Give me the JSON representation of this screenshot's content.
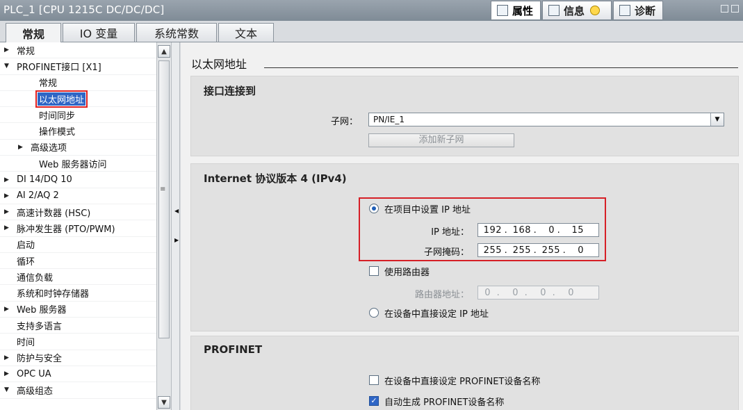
{
  "titlebar": {
    "title": "PLC_1 [CPU 1215C DC/DC/DC]",
    "tabs": [
      {
        "label": "属性",
        "icon": "properties-icon"
      },
      {
        "label": "信息",
        "icon": "info-icon"
      },
      {
        "label": "诊断",
        "icon": "diagnostics-icon"
      }
    ]
  },
  "main_tabs": [
    "常规",
    "IO 变量",
    "系统常数",
    "文本"
  ],
  "tree": [
    {
      "label": "常规",
      "toggle": "▶",
      "indent": 0
    },
    {
      "label": "PROFINET接口 [X1]",
      "toggle": "▼",
      "indent": 0
    },
    {
      "label": "常规",
      "toggle": "",
      "indent": 2
    },
    {
      "label": "以太网地址",
      "toggle": "",
      "indent": 2,
      "selected": true
    },
    {
      "label": "时间同步",
      "toggle": "",
      "indent": 2
    },
    {
      "label": "操作模式",
      "toggle": "",
      "indent": 2
    },
    {
      "label": "高级选项",
      "toggle": "▶",
      "indent": 1
    },
    {
      "label": "Web 服务器访问",
      "toggle": "",
      "indent": 2
    },
    {
      "label": "DI 14/DQ 10",
      "toggle": "▶",
      "indent": 0
    },
    {
      "label": "AI 2/AQ 2",
      "toggle": "▶",
      "indent": 0
    },
    {
      "label": "高速计数器 (HSC)",
      "toggle": "▶",
      "indent": 0
    },
    {
      "label": "脉冲发生器 (PTO/PWM)",
      "toggle": "▶",
      "indent": 0
    },
    {
      "label": "启动",
      "toggle": "",
      "indent": 0
    },
    {
      "label": "循环",
      "toggle": "",
      "indent": 0
    },
    {
      "label": "通信负载",
      "toggle": "",
      "indent": 0
    },
    {
      "label": "系统和时钟存储器",
      "toggle": "",
      "indent": 0
    },
    {
      "label": "Web 服务器",
      "toggle": "▶",
      "indent": 0
    },
    {
      "label": "支持多语言",
      "toggle": "",
      "indent": 0
    },
    {
      "label": "时间",
      "toggle": "",
      "indent": 0
    },
    {
      "label": "防护与安全",
      "toggle": "▶",
      "indent": 0
    },
    {
      "label": "OPC UA",
      "toggle": "▶",
      "indent": 0
    },
    {
      "label": "高级组态",
      "toggle": "▼",
      "indent": 0
    }
  ],
  "content": {
    "page_title": "以太网地址",
    "interface": {
      "title": "接口连接到",
      "subnet_label": "子网：",
      "subnet_value": "PN/IE_1",
      "add_subnet_button": "添加新子网"
    },
    "ipv4": {
      "title": "Internet 协议版本 4 (IPv4)",
      "set_in_project_label": "在项目中设置 IP 地址",
      "ip_label": "IP 地址：",
      "ip": [
        "192",
        "168",
        "0",
        "15"
      ],
      "mask_label": "子网掩码：",
      "mask": [
        "255",
        "255",
        "255",
        "0"
      ],
      "use_router_label": "使用路由器",
      "router_label": "路由器地址：",
      "router": [
        "0",
        "0",
        "0",
        "0"
      ],
      "set_on_device_label": "在设备中直接设定 IP 地址"
    },
    "profinet": {
      "title": "PROFINET",
      "set_name_on_device_label": "在设备中直接设定 PROFINET设备名称",
      "auto_name_label": "自动生成 PROFINET设备名称"
    }
  }
}
